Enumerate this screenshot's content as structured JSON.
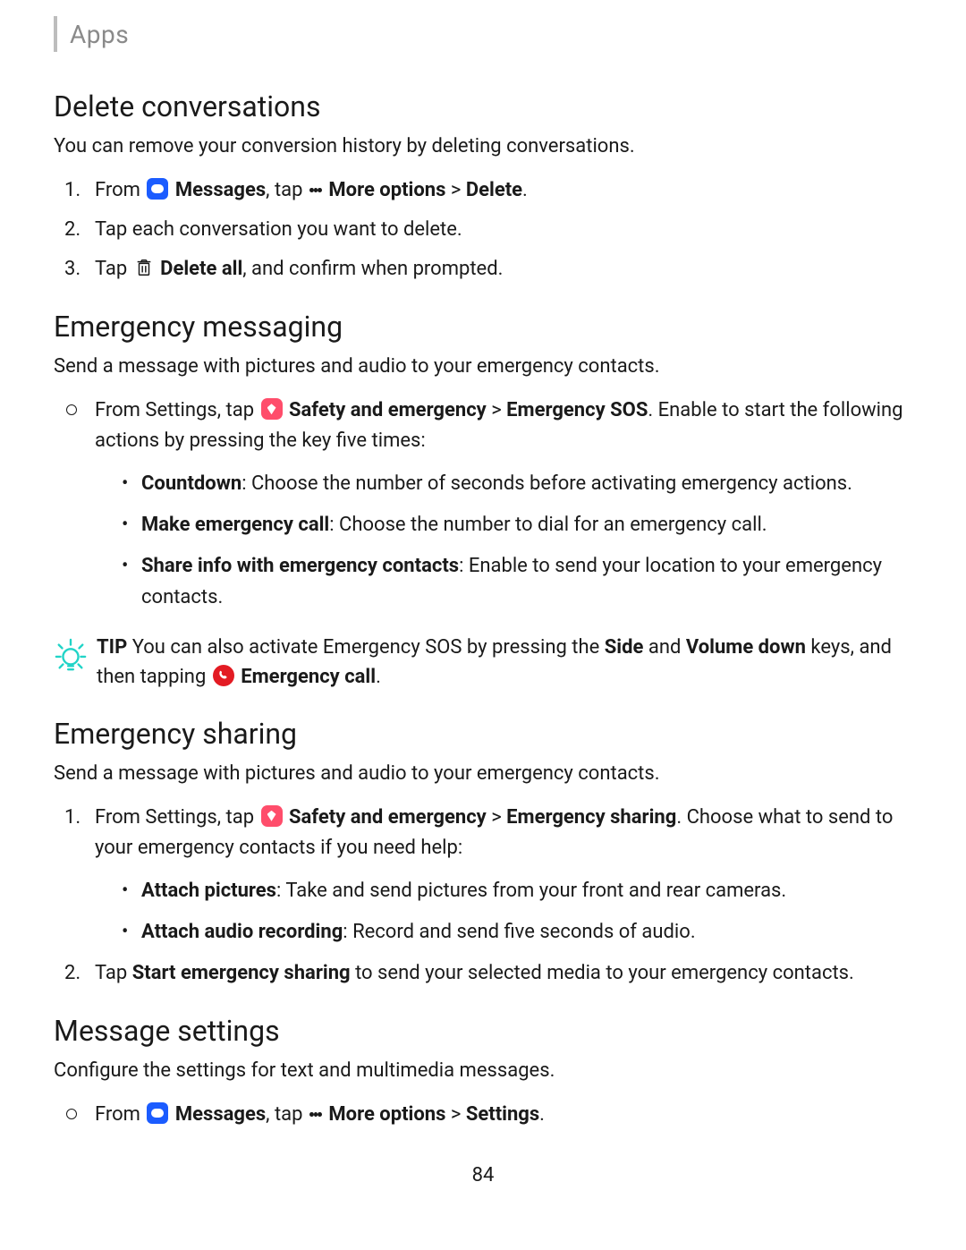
{
  "header": {
    "label": "Apps"
  },
  "s1": {
    "title": "Delete conversations",
    "intro": "You can remove your conversion history by deleting conversations.",
    "step1_a": "From ",
    "step1_messages": "Messages",
    "step1_b": ", tap ",
    "step1_more": "More options",
    "step1_c": " > ",
    "step1_delete": "Delete",
    "step1_d": ".",
    "step2": "Tap each conversation you want to delete.",
    "step3_a": "Tap ",
    "step3_deleteall": "Delete all",
    "step3_b": ", and confirm when prompted."
  },
  "s2": {
    "title": "Emergency messaging",
    "intro": "Send a message with pictures and audio to your emergency contacts.",
    "bul_a": "From Settings, tap ",
    "bul_safety": "Safety and emergency",
    "bul_b": " > ",
    "bul_sos": "Emergency SOS",
    "bul_c": ". Enable to start the following actions by pressing the key five times:",
    "sub1_b": "Countdown",
    "sub1_t": ": Choose the number of seconds before activating emergency actions.",
    "sub2_b": "Make emergency call",
    "sub2_t": ": Choose the number to dial for an emergency call.",
    "sub3_b": "Share info with emergency contacts",
    "sub3_t": ": Enable to send your location to your emergency contacts."
  },
  "tip": {
    "label": "TIP",
    "a": "  You can also activate Emergency SOS by pressing the ",
    "side": "Side",
    "b": " and ",
    "vdown": "Volume down",
    "c": " keys, and then tapping ",
    "ecall": "Emergency call",
    "d": "."
  },
  "s3": {
    "title": "Emergency sharing",
    "intro": "Send a message with pictures and audio to your emergency contacts.",
    "step1_a": "From Settings, tap ",
    "step1_safety": "Safety and emergency",
    "step1_b": " > ",
    "step1_es": "Emergency sharing",
    "step1_c": ". Choose what to send to your emergency contacts if you need help:",
    "sub1_b": "Attach pictures",
    "sub1_t": ": Take and send pictures from your front and rear cameras.",
    "sub2_b": "Attach audio recording",
    "sub2_t": ": Record and send five seconds of audio.",
    "step2_a": "Tap ",
    "step2_start": "Start emergency sharing",
    "step2_b": " to send your selected media to your emergency contacts."
  },
  "s4": {
    "title": "Message settings",
    "intro": "Configure the settings for text and multimedia messages.",
    "bul_a": "From ",
    "bul_messages": "Messages",
    "bul_b": ", tap ",
    "bul_more": "More options",
    "bul_c": " > ",
    "bul_settings": "Settings",
    "bul_d": "."
  },
  "page_number": "84"
}
